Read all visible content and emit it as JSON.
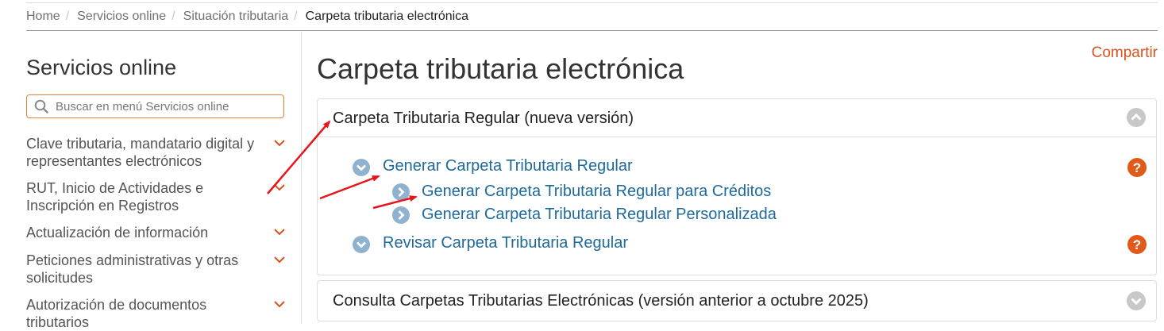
{
  "breadcrumb": {
    "items": [
      "Home",
      "Servicios online",
      "Situación tributaria"
    ],
    "current": "Carpeta tributaria electrónica",
    "separator": "/"
  },
  "sidebar": {
    "title": "Servicios online",
    "search_placeholder": "Buscar en menú Servicios online",
    "items": [
      {
        "label": "Clave tributaria, mandatario digital y representantes electrónicos"
      },
      {
        "label": "RUT, Inicio de Actividades e Inscripción en Registros"
      },
      {
        "label": "Actualización de información"
      },
      {
        "label": "Peticiones administrativas y otras solicitudes"
      },
      {
        "label": "Autorización de documentos tributarios"
      }
    ]
  },
  "main": {
    "title": "Carpeta tributaria electrónica",
    "share_label": "Compartir",
    "panels": [
      {
        "title": "Carpeta Tributaria Regular (nueva versión)",
        "expanded": true,
        "links": [
          {
            "label": "Generar Carpeta Tributaria Regular",
            "has_help": true
          },
          {
            "label": "Generar Carpeta Tributaria Regular para Créditos"
          },
          {
            "label": "Generar Carpeta Tributaria Regular Personalizada"
          },
          {
            "label": "Revisar Carpeta Tributaria Regular",
            "has_help": true
          }
        ]
      },
      {
        "title": "Consulta Carpetas Tributarias Electrónicas (versión anterior a octubre 2025)",
        "expanded": false
      }
    ]
  },
  "icons": {
    "search": "search-icon",
    "menu_chevron": "chevron-down-icon",
    "panel_toggle_open": "chevron-up-circle-icon",
    "panel_toggle_closed": "chevron-down-circle-icon",
    "link_expand": "chevron-down-circle-icon",
    "link_arrow": "chevron-right-circle-icon",
    "help": "question-circle-icon"
  },
  "colors": {
    "accent": "#d9531e",
    "link": "#1f6a9c",
    "link_icon": "#8fb3cf",
    "help": "#e05a1a",
    "toggle": "#c8c8c8",
    "annotation": "#e8141c"
  }
}
